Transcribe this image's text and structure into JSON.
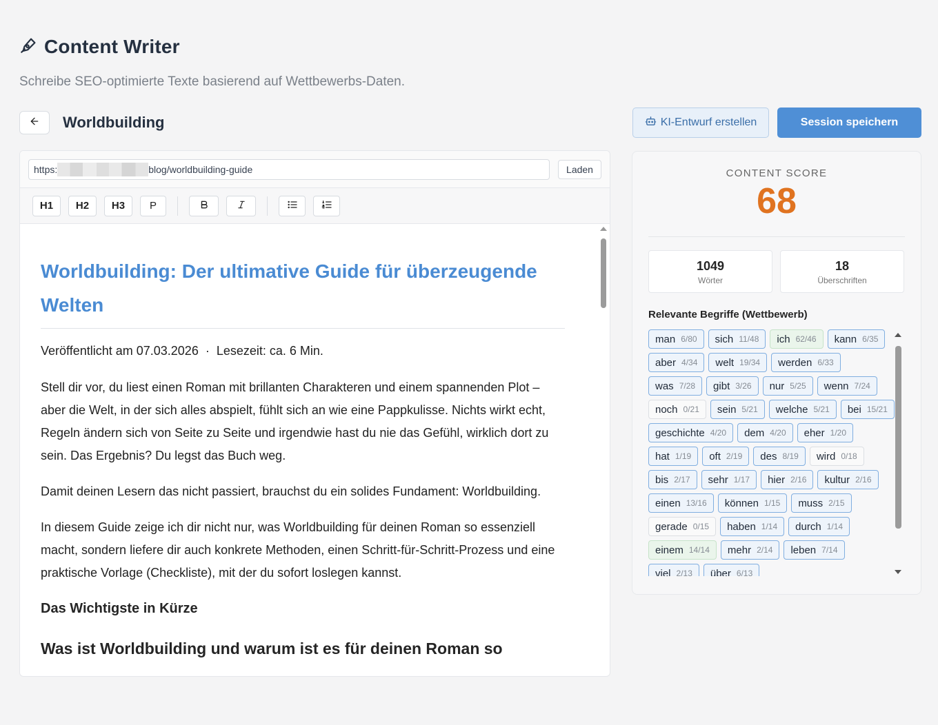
{
  "header": {
    "title": "Content Writer",
    "subtitle": "Schreibe SEO-optimierte Texte basierend auf Wettbewerbs-Daten."
  },
  "topbar": {
    "doc_title": "Worldbuilding",
    "ki_button": "KI-Entwurf erstellen",
    "save_button": "Session speichern"
  },
  "url": {
    "prefix": "https:",
    "suffix": "blog/worldbuilding-guide",
    "load_button": "Laden"
  },
  "toolbar": {
    "h1": "H1",
    "h2": "H2",
    "h3": "H3",
    "p": "P"
  },
  "content": {
    "heading": "Worldbuilding: Der ultimative Guide für überzeugende Welten",
    "meta": "Veröffentlicht am 07.03.2026  ·  Lesezeit: ca. 6 Min.",
    "p1": "Stell dir vor, du liest einen Roman mit brillanten Charakteren und einem spannenden Plot – aber die Welt, in der sich alles abspielt, fühlt sich an wie eine Pappkulisse. Nichts wirkt echt, Regeln ändern sich von Seite zu Seite und irgendwie hast du nie das Gefühl, wirklich dort zu sein. Das Ergebnis? Du legst das Buch weg.",
    "p2": "Damit deinen Lesern das nicht passiert, brauchst du ein solides Fundament: Worldbuilding.",
    "p3": "In diesem Guide zeige ich dir nicht nur, was Worldbuilding für deinen Roman so essenziell macht, sondern liefere dir auch konkrete Methoden, einen Schritt-für-Schritt-Prozess und eine praktische Vorlage (Checkliste), mit der du sofort loslegen kannst.",
    "h3": "Das Wichtigste in Kürze",
    "h2": "Was ist Worldbuilding und warum ist es für deinen Roman so"
  },
  "score": {
    "label": "CONTENT SCORE",
    "value": "68",
    "words": "1049",
    "words_label": "Wörter",
    "headings": "18",
    "headings_label": "Überschriften",
    "terms_title": "Relevante Begriffe (Wettbewerb)",
    "terms": [
      {
        "term": "man",
        "count": "6/80",
        "status": "partial"
      },
      {
        "term": "sich",
        "count": "11/48",
        "status": "partial"
      },
      {
        "term": "ich",
        "count": "62/46",
        "status": "ok"
      },
      {
        "term": "kann",
        "count": "6/35",
        "status": "partial"
      },
      {
        "term": "aber",
        "count": "4/34",
        "status": "partial"
      },
      {
        "term": "welt",
        "count": "19/34",
        "status": "partial"
      },
      {
        "term": "werden",
        "count": "6/33",
        "status": "partial"
      },
      {
        "term": "was",
        "count": "7/28",
        "status": "partial"
      },
      {
        "term": "gibt",
        "count": "3/26",
        "status": "partial"
      },
      {
        "term": "nur",
        "count": "5/25",
        "status": "partial"
      },
      {
        "term": "wenn",
        "count": "7/24",
        "status": "partial"
      },
      {
        "term": "noch",
        "count": "0/21",
        "status": "none"
      },
      {
        "term": "sein",
        "count": "5/21",
        "status": "partial"
      },
      {
        "term": "welche",
        "count": "5/21",
        "status": "partial"
      },
      {
        "term": "bei",
        "count": "15/21",
        "status": "partial"
      },
      {
        "term": "geschichte",
        "count": "4/20",
        "status": "partial"
      },
      {
        "term": "dem",
        "count": "4/20",
        "status": "partial"
      },
      {
        "term": "eher",
        "count": "1/20",
        "status": "partial"
      },
      {
        "term": "hat",
        "count": "1/19",
        "status": "partial"
      },
      {
        "term": "oft",
        "count": "2/19",
        "status": "partial"
      },
      {
        "term": "des",
        "count": "8/19",
        "status": "partial"
      },
      {
        "term": "wird",
        "count": "0/18",
        "status": "none"
      },
      {
        "term": "bis",
        "count": "2/17",
        "status": "partial"
      },
      {
        "term": "sehr",
        "count": "1/17",
        "status": "partial"
      },
      {
        "term": "hier",
        "count": "2/16",
        "status": "partial"
      },
      {
        "term": "kultur",
        "count": "2/16",
        "status": "partial"
      },
      {
        "term": "einen",
        "count": "13/16",
        "status": "partial"
      },
      {
        "term": "können",
        "count": "1/15",
        "status": "partial"
      },
      {
        "term": "muss",
        "count": "2/15",
        "status": "partial"
      },
      {
        "term": "gerade",
        "count": "0/15",
        "status": "none"
      },
      {
        "term": "haben",
        "count": "1/14",
        "status": "partial"
      },
      {
        "term": "durch",
        "count": "1/14",
        "status": "partial"
      },
      {
        "term": "einem",
        "count": "14/14",
        "status": "ok"
      },
      {
        "term": "mehr",
        "count": "2/14",
        "status": "partial"
      },
      {
        "term": "leben",
        "count": "7/14",
        "status": "partial"
      },
      {
        "term": "viel",
        "count": "2/13",
        "status": "partial"
      },
      {
        "term": "über",
        "count": "6/13",
        "status": "partial"
      }
    ]
  },
  "colors": {
    "accent": "#4f8fd6",
    "score": "#e07320",
    "heading_link": "#4a8bd3"
  }
}
